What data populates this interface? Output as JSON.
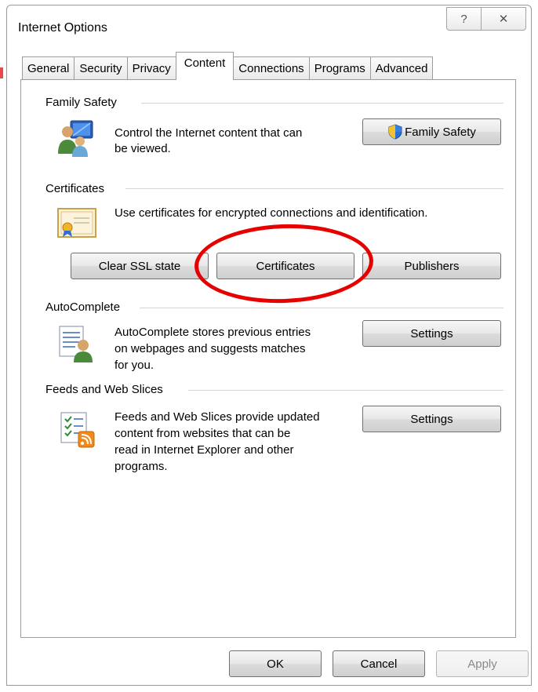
{
  "window": {
    "title": "Internet Options",
    "help_glyph": "?",
    "close_glyph": "✕"
  },
  "tabs": [
    {
      "label": "General",
      "active": false
    },
    {
      "label": "Security",
      "active": false
    },
    {
      "label": "Privacy",
      "active": false
    },
    {
      "label": "Content",
      "active": true
    },
    {
      "label": "Connections",
      "active": false
    },
    {
      "label": "Programs",
      "active": false
    },
    {
      "label": "Advanced",
      "active": false
    }
  ],
  "family_safety": {
    "heading": "Family Safety",
    "description_line1": "Control the Internet content that can",
    "description_line2": "be viewed.",
    "button_label": "Family Safety",
    "icon": "parental-controls-icon"
  },
  "certificates": {
    "heading": "Certificates",
    "description": "Use certificates for encrypted connections and identification.",
    "clear_ssl_label": "Clear SSL state",
    "certificates_label": "Certificates",
    "publishers_label": "Publishers",
    "icon": "certificate-icon",
    "highlight_color": "#e60000"
  },
  "autocomplete": {
    "heading": "AutoComplete",
    "description_line1": "AutoComplete stores previous entries",
    "description_line2": "on webpages and suggests matches",
    "description_line3": "for you.",
    "settings_label": "Settings",
    "icon": "autocomplete-icon"
  },
  "feeds": {
    "heading": "Feeds and Web Slices",
    "description_line1": "Feeds and Web Slices provide updated",
    "description_line2": "content from websites that can be",
    "description_line3": "read in Internet Explorer and other",
    "description_line4": "programs.",
    "settings_label": "Settings",
    "icon": "feeds-icon"
  },
  "footer": {
    "ok_label": "OK",
    "cancel_label": "Cancel",
    "apply_label": "Apply",
    "apply_enabled": false
  }
}
